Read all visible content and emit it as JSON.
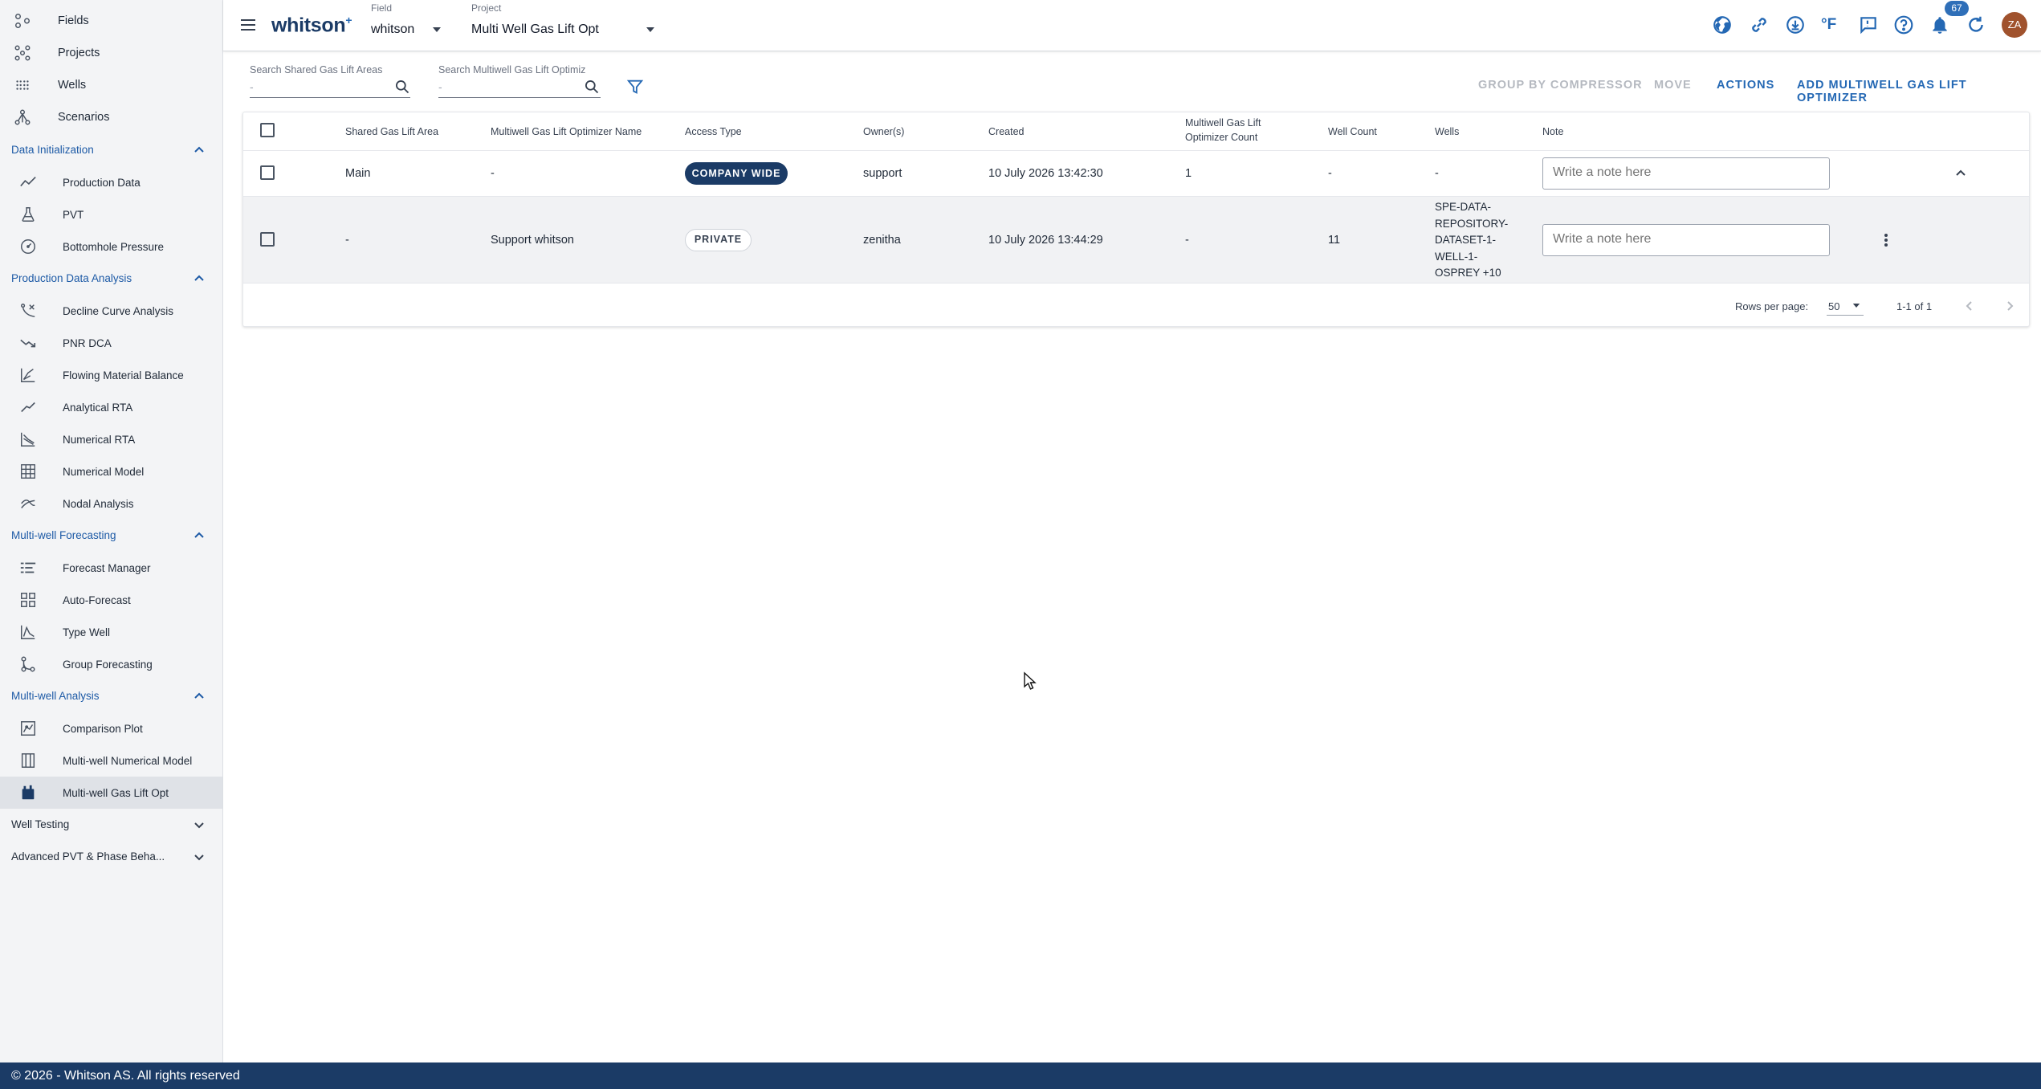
{
  "sidebar": {
    "top_items": [
      {
        "label": "Fields",
        "icon": "fields-icon"
      },
      {
        "label": "Projects",
        "icon": "projects-icon"
      },
      {
        "label": "Wells",
        "icon": "wells-icon"
      },
      {
        "label": "Scenarios",
        "icon": "scenarios-icon"
      }
    ],
    "sections": [
      {
        "title": "Data Initialization",
        "items": [
          "Production Data",
          "PVT",
          "Bottomhole Pressure"
        ]
      },
      {
        "title": "Production Data Analysis",
        "items": [
          "Decline Curve Analysis",
          "PNR DCA",
          "Flowing Material Balance",
          "Analytical RTA",
          "Numerical RTA",
          "Numerical Model",
          "Nodal Analysis"
        ]
      },
      {
        "title": "Multi-well Forecasting",
        "items": [
          "Forecast Manager",
          "Auto-Forecast",
          "Type Well",
          "Group Forecasting"
        ]
      },
      {
        "title": "Multi-well Analysis",
        "items": [
          "Comparison Plot",
          "Multi-well Numerical Model",
          "Multi-well Gas Lift Opt"
        ]
      },
      {
        "title": "Well Testing",
        "items": []
      },
      {
        "title": "Advanced PVT & Phase Beha...",
        "items": []
      }
    ],
    "active_item": "Multi-well Gas Lift Opt"
  },
  "header": {
    "brand": "whitson",
    "brand_plus": "+",
    "field_label": "Field",
    "field_value": "whitson",
    "project_label": "Project",
    "project_value": "Multi Well Gas Lift Opt",
    "notification_count": "67",
    "avatar_initials": "ZA",
    "unit_label": "°F"
  },
  "toolbar": {
    "search1_label": "Search Shared Gas Lift Areas",
    "search1_value": "-",
    "search2_label": "Search Multiwell Gas Lift Optimiz",
    "search2_value": "-",
    "group_by_compressor": "GROUP BY COMPRESSOR",
    "move": "MOVE",
    "actions": "ACTIONS",
    "add": "ADD MULTIWELL GAS LIFT OPTIMIZER"
  },
  "table": {
    "headers": {
      "area": "Shared Gas Lift Area",
      "name": "Multiwell Gas Lift Optimizer Name",
      "access": "Access Type",
      "owners": "Owner(s)",
      "created": "Created",
      "count_line1": "Multiwell Gas Lift",
      "count_line2": "Optimizer Count",
      "well_count": "Well Count",
      "wells": "Wells",
      "note": "Note"
    },
    "rows": [
      {
        "area": "Main",
        "name": "-",
        "access": "COMPANY WIDE",
        "owner": "support",
        "created": "10 July 2026 13:42:30",
        "optimizer_count": "1",
        "well_count": "-",
        "wells": "-",
        "note_placeholder": "Write a note here"
      },
      {
        "area": "-",
        "name": "Support whitson",
        "access": "PRIVATE",
        "owner": "zenitha",
        "created": "10 July 2026 13:44:29",
        "optimizer_count": "-",
        "well_count": "11",
        "wells_lines": [
          "SPE-DATA-",
          "REPOSITORY-",
          "DATASET-1-",
          "WELL-1-",
          "OSPREY +10"
        ],
        "note_placeholder": "Write a note here"
      }
    ],
    "pagination": {
      "rows_per_page_label": "Rows per page:",
      "rows_per_page": "50",
      "range": "1-1 of 1"
    }
  },
  "footer": {
    "copyright": "© 2026 - Whitson AS. All rights reserved"
  },
  "colors": {
    "primary": "#2468b4",
    "navy": "#1b3b66",
    "sidebar_bg": "#f3f4f6"
  }
}
